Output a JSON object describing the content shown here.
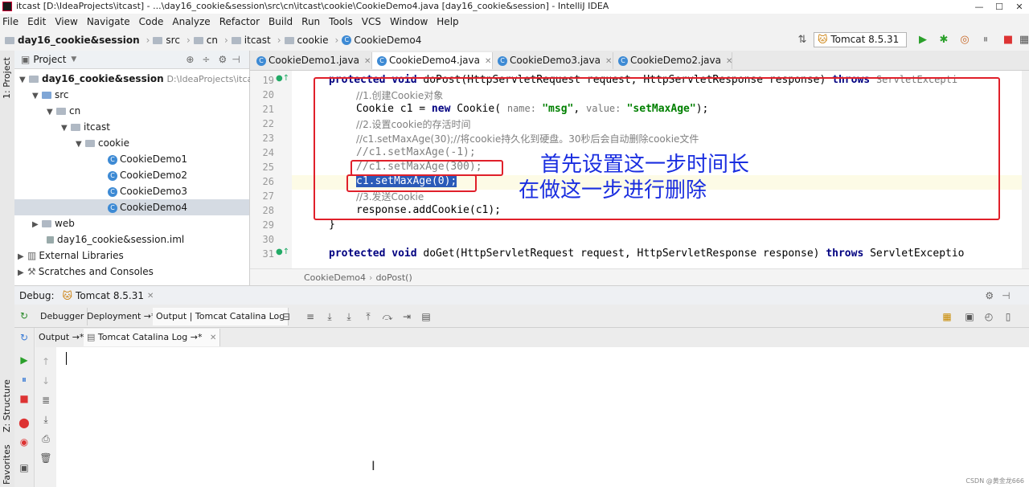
{
  "window": {
    "title": "itcast [D:\\IdeaProjects\\itcast] - ...\\day16_cookie&session\\src\\cn\\itcast\\cookie\\CookieDemo4.java [day16_cookie&session] - IntelliJ IDEA",
    "minimize": "—",
    "maximize": "☐",
    "close": "✕"
  },
  "menu": [
    "File",
    "Edit",
    "View",
    "Navigate",
    "Code",
    "Analyze",
    "Refactor",
    "Build",
    "Run",
    "Tools",
    "VCS",
    "Window",
    "Help"
  ],
  "nav": {
    "breadcrumbs": [
      "day16_cookie&session",
      "src",
      "cn",
      "itcast",
      "cookie",
      "CookieDemo4"
    ],
    "run_config": "Tomcat 8.5.31"
  },
  "left_strip": {
    "project": "1: Project",
    "structure": "Z: Structure",
    "favorites": "Favorites"
  },
  "project": {
    "header": "Project",
    "tree": [
      {
        "label": "day16_cookie&session",
        "path": "D:\\IdeaProjects\\itcast"
      },
      {
        "label": "src"
      },
      {
        "label": "cn"
      },
      {
        "label": "itcast"
      },
      {
        "label": "cookie"
      },
      {
        "label": "CookieDemo1"
      },
      {
        "label": "CookieDemo2"
      },
      {
        "label": "CookieDemo3"
      },
      {
        "label": "CookieDemo4"
      },
      {
        "label": "web"
      },
      {
        "label": "day16_cookie&session.iml"
      },
      {
        "label": "External Libraries"
      },
      {
        "label": "Scratches and Consoles"
      }
    ]
  },
  "editor": {
    "tabs": [
      "CookieDemo1.java",
      "CookieDemo4.java",
      "CookieDemo3.java",
      "CookieDemo2.java"
    ],
    "line_numbers": [
      "19",
      "20",
      "21",
      "22",
      "23",
      "24",
      "25",
      "26",
      "27",
      "28",
      "29",
      "30",
      "31"
    ],
    "lines": {
      "l19": {
        "kw1": "protected void ",
        "text": "doPost(HttpServletRequest request, HttpServletResponse response) ",
        "kw2": "throws ",
        "rest": "ServletExcepti"
      },
      "l20": "//1.创建Cookie对象",
      "l21": {
        "a": "Cookie c1 = ",
        "kw": "new ",
        "b": "Cookie( ",
        "hint1": "name: ",
        "s1": "\"msg\"",
        "c": ", ",
        "hint2": "value: ",
        "s2": "\"setMaxAge\"",
        "d": ");"
      },
      "l22": "//2.设置cookie的存活时间",
      "l23": "//c1.setMaxAge(30);//将cookie持久化到硬盘。30秒后会自动删除cookie文件",
      "l24": "//c1.setMaxAge(-1);",
      "l25": "//c1.setMaxAge(300);",
      "l26": "c1.setMaxAge(0);",
      "l27": "//3.发送Cookie",
      "l28": "response.addCookie(c1);",
      "l29": "}",
      "l31": {
        "kw1": "protected void ",
        "text": "doGet(HttpServletRequest request, HttpServletResponse response) ",
        "kw2": "throws ",
        "rest": "ServletExceptio"
      }
    },
    "breadcrumb": [
      "CookieDemo4",
      "doPost()"
    ]
  },
  "annotations": {
    "first": "首先设置这一步时间长",
    "second": "在做这一步进行删除"
  },
  "debug": {
    "label": "Debug:",
    "config": "Tomcat 8.5.31",
    "tabs": [
      "Debugger",
      "Deployment →*",
      "Output | Tomcat Catalina Log"
    ],
    "subtabs": [
      "Output →*",
      "Tomcat Catalina Log →*"
    ]
  },
  "watermark": "CSDN @黄金龙666",
  "colors": {
    "annotation_box": "#e0202a",
    "annotation_text": "#1a2ee0",
    "keyword": "#000080",
    "string": "#008000"
  }
}
